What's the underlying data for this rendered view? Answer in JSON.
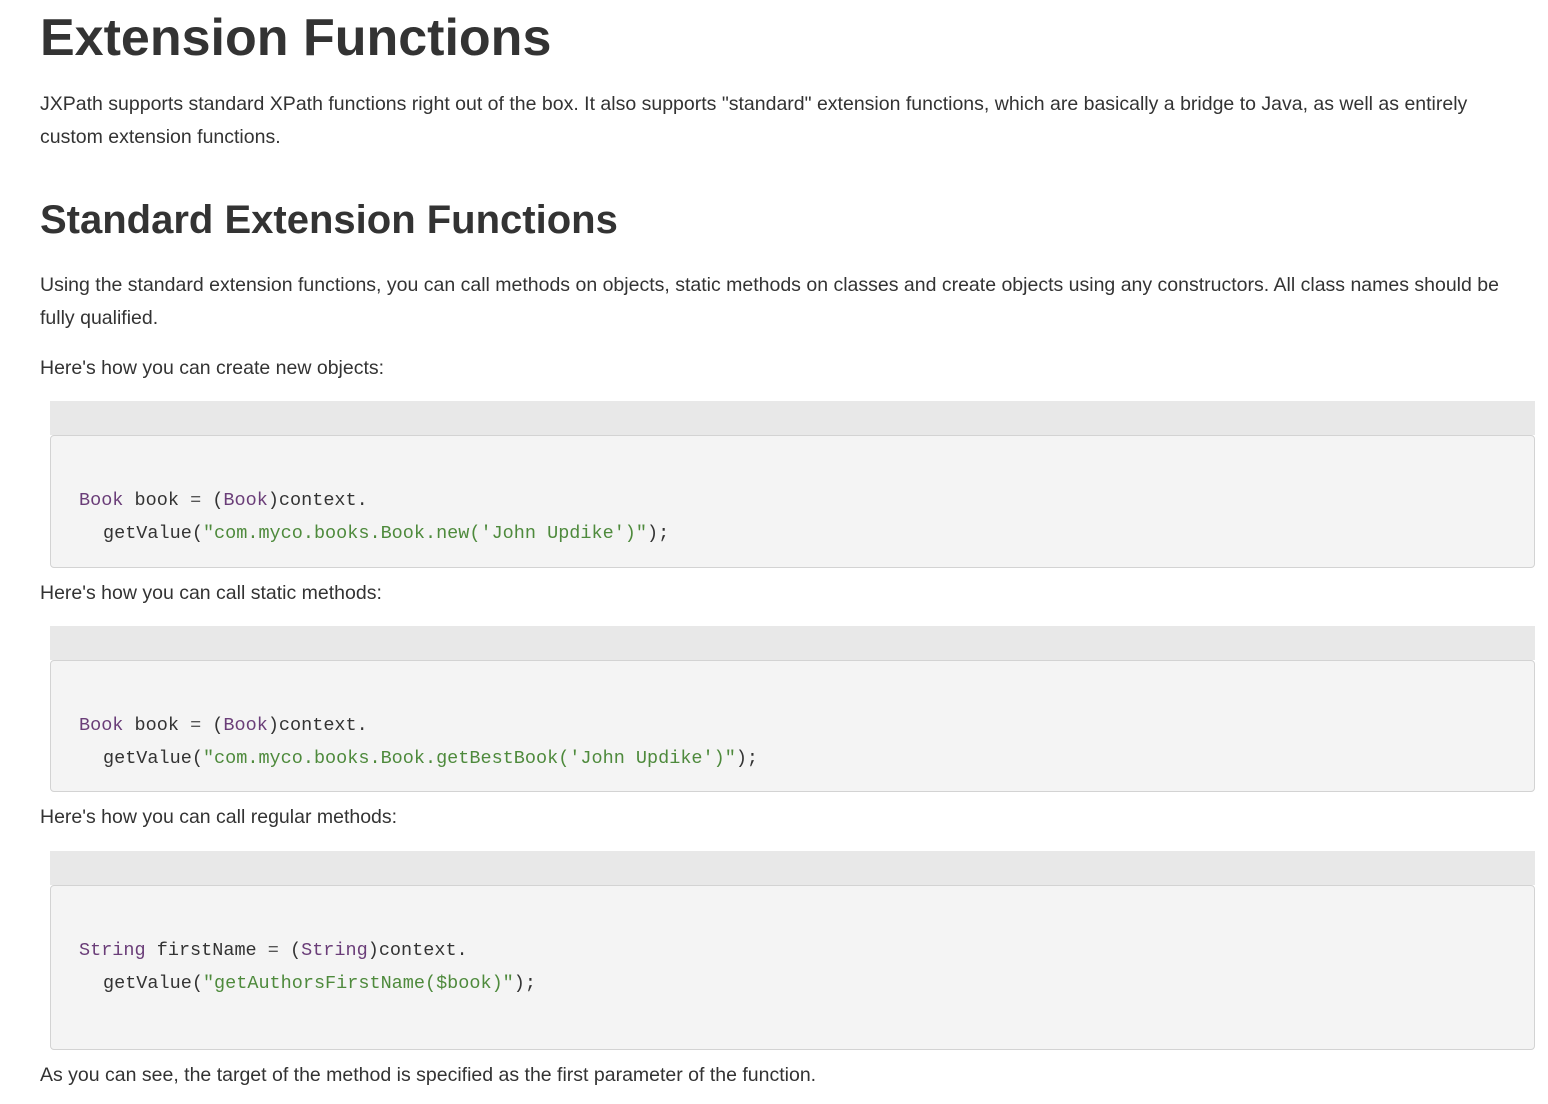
{
  "heading_main": "Extension Functions",
  "intro_text": "JXPath supports standard XPath functions right out of the box. It also supports \"standard\" extension functions, which are basically a bridge to Java, as well as entirely custom extension functions.",
  "heading_standard": "Standard Extension Functions",
  "standard_text": "Using the standard extension functions, you can call methods on objects, static methods on classes and create objects using any constructors. All class names should be fully qualified.",
  "new_objects_text": "Here's how you can create new objects:",
  "static_methods_text": "Here's how you can call static methods:",
  "regular_methods_text": "Here's how you can call regular methods:",
  "outro_text": "As you can see, the target of the method is specified as the first parameter of the function.",
  "code_blocks": [
    {
      "type_name": "Book",
      "var_name": "book",
      "equals": "=",
      "cast_open": "(",
      "cast_type": "Book",
      "cast_close": ")",
      "receiver": "context.",
      "method": "getValue",
      "paren_open": "(",
      "string_value": "\"com.myco.books.Book.new('John Updike')\"",
      "paren_close": ");"
    },
    {
      "type_name": "Book",
      "var_name": "book",
      "equals": "=",
      "cast_open": "(",
      "cast_type": "Book",
      "cast_close": ")",
      "receiver": "context.",
      "method": "getValue",
      "paren_open": "(",
      "string_value": "\"com.myco.books.Book.getBestBook('John Updike')\"",
      "paren_close": ");"
    },
    {
      "type_name": "String",
      "var_name": "firstName",
      "equals": "=",
      "cast_open": "(",
      "cast_type": "String",
      "cast_close": ")",
      "receiver": "context.",
      "method": "getValue",
      "paren_open": "(",
      "string_value": "\"getAuthorsFirstName($book)\"",
      "paren_close": ");"
    }
  ],
  "colors": {
    "text": "#333333",
    "code_type": "#6a3d78",
    "code_string": "#4e8a3c",
    "code_background": "#f4f4f4",
    "code_header": "#e8e8e8",
    "code_border": "#d3d3d3"
  }
}
